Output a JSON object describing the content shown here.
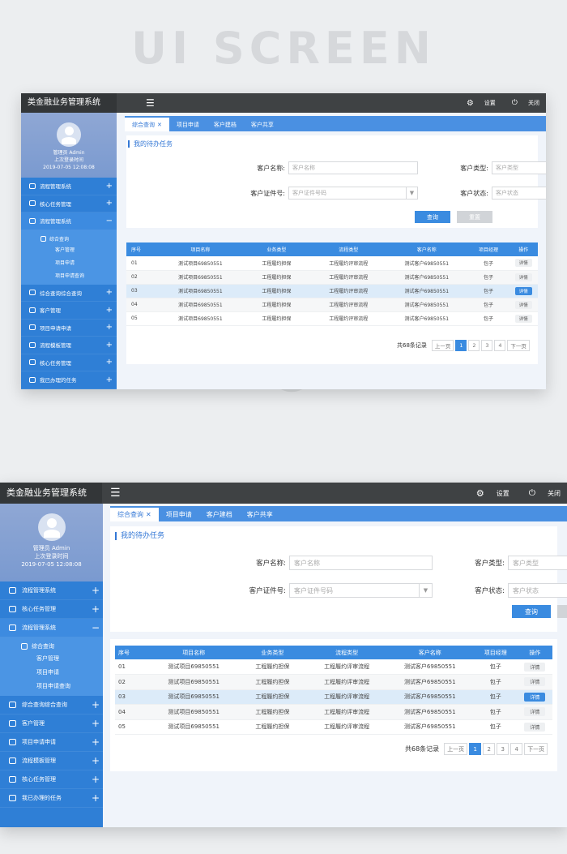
{
  "hero": "UI SCREEN",
  "app": {
    "title": "类金融业务管理系统",
    "settings_label": "设置",
    "close_label": "关闭",
    "user_name": "管理员 Admin",
    "last_login_label": "上次登录时间",
    "last_login_time": "2019-07-05 12:08:08",
    "menu": [
      {
        "label": "流程管理系统"
      },
      {
        "label": "核心任务管理"
      },
      {
        "label": "流程管理系统"
      },
      {
        "label": "综合查询综合查询"
      },
      {
        "label": "客户管理"
      },
      {
        "label": "项目申请申请"
      },
      {
        "label": "流程模板管理"
      },
      {
        "label": "核心任务管理"
      },
      {
        "label": "我已办理的任务"
      }
    ],
    "submenu_title": "综合查询",
    "submenu_links": [
      "客户管理",
      "项目申请",
      "项目申请查询"
    ],
    "tabs": [
      "综合查询",
      "项目申请",
      "客户建档",
      "客户共享"
    ],
    "panel_title": "我的待办任务",
    "form": {
      "name_label": "客户名称:",
      "name_placeholder": "客户名称",
      "type_label": "客户类型:",
      "type_placeholder": "客户类型",
      "id_label": "客户证件号:",
      "id_placeholder": "客户证件号码",
      "status_label": "客户状态:",
      "status_placeholder": "客户状态",
      "query": "查询",
      "reset": "重置"
    },
    "table": {
      "headers": [
        "序号",
        "项目名称",
        "业务类型",
        "流程类型",
        "客户名称",
        "项目经理",
        "操作"
      ],
      "rows": [
        [
          "01",
          "测试项目69850551",
          "工程履约担保",
          "工程履约评审流程",
          "测试客户69850551",
          "包子",
          "详情"
        ],
        [
          "02",
          "测试项目69850551",
          "工程履约担保",
          "工程履约评审流程",
          "测试客户69850551",
          "包子",
          "详情"
        ],
        [
          "03",
          "测试项目69850551",
          "工程履约担保",
          "工程履约评审流程",
          "测试客户69850551",
          "包子",
          "详情"
        ],
        [
          "04",
          "测试项目69850551",
          "工程履约担保",
          "工程履约评审流程",
          "测试客户69850551",
          "包子",
          "详情"
        ],
        [
          "05",
          "测试项目69850551",
          "工程履约担保",
          "工程履约评审流程",
          "测试客户69850551",
          "包子",
          "详情"
        ]
      ],
      "selected_row": 3
    },
    "pager": {
      "total": "共68条记录",
      "prev": "上一页",
      "pages": [
        "1",
        "2",
        "3",
        "4"
      ],
      "current": "1",
      "next": "下一页"
    }
  },
  "colors": {
    "topbar": "#3f4244",
    "sidebar": "#2f7fd6",
    "accent": "#3a8be0",
    "selected_row": "#dcebf9"
  }
}
